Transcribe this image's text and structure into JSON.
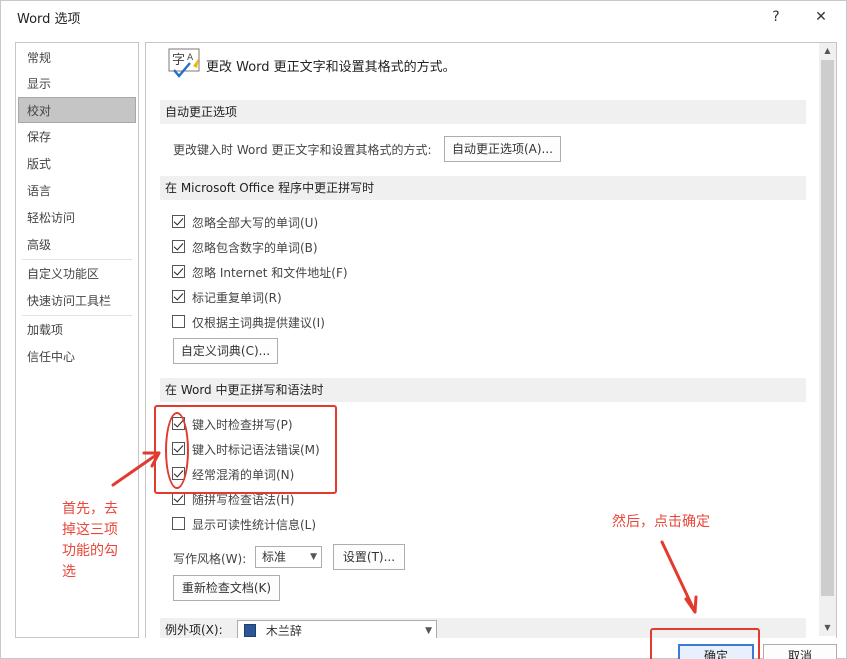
{
  "window": {
    "title": "Word 选项",
    "help": "?",
    "close": "✕"
  },
  "sidebar": {
    "items": [
      {
        "label": "常规"
      },
      {
        "label": "显示"
      },
      {
        "label": "校对"
      },
      {
        "label": "保存"
      },
      {
        "label": "版式"
      },
      {
        "label": "语言"
      },
      {
        "label": "轻松访问"
      },
      {
        "label": "高级"
      },
      {
        "label": "自定义功能区"
      },
      {
        "label": "快速访问工具栏"
      },
      {
        "label": "加载项"
      },
      {
        "label": "信任中心"
      }
    ],
    "selected": "校对"
  },
  "intro": {
    "text": "更改 Word 更正文字和设置其格式的方式。",
    "icon": "proofing-icon"
  },
  "autocorrect": {
    "heading": "自动更正选项",
    "description": "更改键入时 Word 更正文字和设置其格式的方式:",
    "button": "自动更正选项(A)..."
  },
  "office_spelling": {
    "heading": "在 Microsoft Office 程序中更正拼写时",
    "options": [
      {
        "label": "忽略全部大写的单词(U)",
        "checked": true
      },
      {
        "label": "忽略包含数字的单词(B)",
        "checked": true
      },
      {
        "label": "忽略 Internet 和文件地址(F)",
        "checked": true
      },
      {
        "label": "标记重复单词(R)",
        "checked": true
      },
      {
        "label": "仅根据主词典提供建议(I)",
        "checked": false
      }
    ],
    "custom_dict_button": "自定义词典(C)..."
  },
  "word_spelling": {
    "heading": "在 Word 中更正拼写和语法时",
    "options": [
      {
        "label": "键入时检查拼写(P)",
        "checked": true
      },
      {
        "label": "键入时标记语法错误(M)",
        "checked": true
      },
      {
        "label": "经常混淆的单词(N)",
        "checked": true
      },
      {
        "label": "随拼写检查语法(H)",
        "checked": true
      },
      {
        "label": "显示可读性统计信息(L)",
        "checked": false
      }
    ],
    "writing_style_label": "写作风格(W):",
    "writing_style_value": "标准",
    "settings_button": "设置(T)...",
    "recheck_button": "重新检查文档(K)"
  },
  "exceptions": {
    "label": "例外项(X):",
    "value": "木兰辞"
  },
  "footer": {
    "ok": "确定",
    "cancel": "取消"
  },
  "annotations": {
    "left_note": [
      "首先，去",
      "掉这三项",
      "功能的勾",
      "选"
    ],
    "right_note": "然后，点击确定",
    "color": "#e23a2e"
  }
}
